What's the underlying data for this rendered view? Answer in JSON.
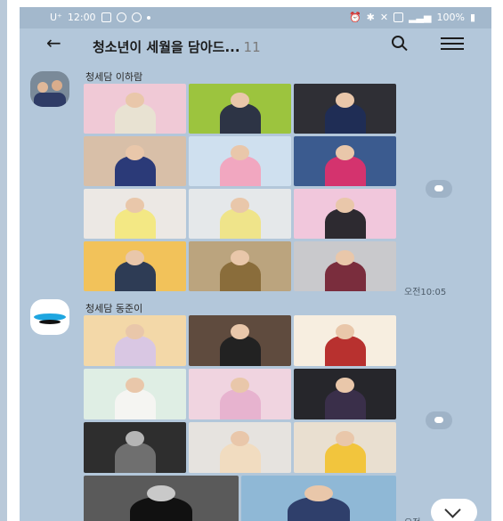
{
  "status_bar": {
    "carrier": "U⁺",
    "time": "12:00",
    "battery": "100%"
  },
  "header": {
    "title": "청소년이 세월을 담아드...",
    "count": "11"
  },
  "messages": [
    {
      "sender": "청세담 이하람",
      "time": "오전10:05"
    },
    {
      "sender": "청세담 동준이",
      "time": "오전"
    }
  ],
  "colors": {
    "chat_bg": "#b3c7da",
    "status_bg": "#a3b8cc"
  }
}
